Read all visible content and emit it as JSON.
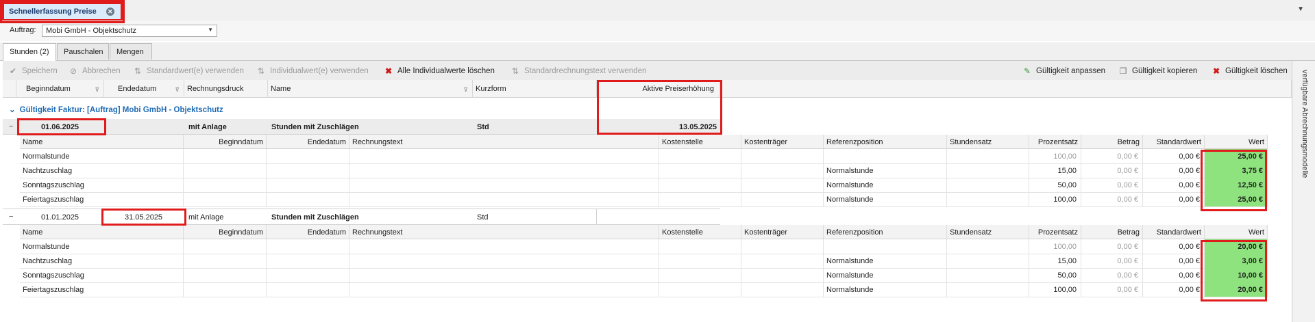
{
  "tab_doc": {
    "label": "Schnellerfassung Preise"
  },
  "auftrag": {
    "label": "Auftrag:",
    "value": "Mobi GmbH - Objektschutz"
  },
  "tabs": [
    {
      "label": "Stunden (2)",
      "active": true
    },
    {
      "label": "Pauschalen",
      "active": false
    },
    {
      "label": "Mengen",
      "active": false
    }
  ],
  "toolbar": {
    "speichern": "Speichern",
    "abbrechen": "Abbrechen",
    "standardwert": "Standardwert(e) verwenden",
    "individualwert": "Individualwert(e) verwenden",
    "alle_loeschen": "Alle Individualwerte löschen",
    "standardrechnungstext": "Standardrechnungstext verwenden",
    "gueltigkeit_anpassen": "Gültigkeit anpassen",
    "gueltigkeit_kopieren": "Gültigkeit kopieren",
    "gueltigkeit_loeschen": "Gültigkeit löschen"
  },
  "sidebar": {
    "label": "verfügbare Abrechnungsmodelle"
  },
  "grid_headers": {
    "beginndatum": "Beginndatum",
    "endedatum": "Endedatum",
    "rechnungsdruck": "Rechnungsdruck",
    "name": "Name",
    "kurzform": "Kurzform",
    "aktive_preiserhoehung": "Aktive Preiserhöhung"
  },
  "group": {
    "label": "Gültigkeit Faktur: [Auftrag] Mobi GmbH - Objektschutz"
  },
  "sub_headers": {
    "name": "Name",
    "beginndatum": "Beginndatum",
    "endedatum": "Endedatum",
    "rechnungstext": "Rechnungstext",
    "kostenstelle": "Kostenstelle",
    "kostentraeger": "Kostenträger",
    "referenzposition": "Referenzposition",
    "stundensatz": "Stundensatz",
    "prozentsatz": "Prozentsatz",
    "betrag": "Betrag",
    "standardwert": "Standardwert",
    "wert": "Wert"
  },
  "blocks": [
    {
      "beginndatum": "01.06.2025",
      "endedatum": "",
      "rechnungsdruck": "mit Anlage",
      "name": "Stunden mit Zuschlägen",
      "kurzform": "Std",
      "preiserhoehung": "13.05.2025",
      "rows": [
        {
          "name": "Normalstunde",
          "referenz": "",
          "prozent": "100,00",
          "betrag": "0,00 €",
          "standard": "0,00 €",
          "wert": "25,00 €"
        },
        {
          "name": "Nachtzuschlag",
          "referenz": "Normalstunde",
          "prozent": "15,00",
          "betrag": "0,00 €",
          "standard": "0,00 €",
          "wert": "3,75 €"
        },
        {
          "name": "Sonntagszuschlag",
          "referenz": "Normalstunde",
          "prozent": "50,00",
          "betrag": "0,00 €",
          "standard": "0,00 €",
          "wert": "12,50 €"
        },
        {
          "name": "Feiertagszuschlag",
          "referenz": "Normalstunde",
          "prozent": "100,00",
          "betrag": "0,00 €",
          "standard": "0,00 €",
          "wert": "25,00 €"
        }
      ]
    },
    {
      "beginndatum": "01.01.2025",
      "endedatum": "31.05.2025",
      "rechnungsdruck": "mit Anlage",
      "name": "Stunden mit Zuschlägen",
      "kurzform": "Std",
      "preiserhoehung": "",
      "rows": [
        {
          "name": "Normalstunde",
          "referenz": "",
          "prozent": "100,00",
          "betrag": "0,00 €",
          "standard": "0,00 €",
          "wert": "20,00 €"
        },
        {
          "name": "Nachtzuschlag",
          "referenz": "Normalstunde",
          "prozent": "15,00",
          "betrag": "0,00 €",
          "standard": "0,00 €",
          "wert": "3,00 €"
        },
        {
          "name": "Sonntagszuschlag",
          "referenz": "Normalstunde",
          "prozent": "50,00",
          "betrag": "0,00 €",
          "standard": "0,00 €",
          "wert": "10,00 €"
        },
        {
          "name": "Feiertagszuschlag",
          "referenz": "Normalstunde",
          "prozent": "100,00",
          "betrag": "0,00 €",
          "standard": "0,00 €",
          "wert": "20,00 €"
        }
      ]
    }
  ],
  "colors": {
    "highlight": "#e01b1b",
    "value_fill": "#8fe37f",
    "group_text": "#1f6bb4"
  }
}
